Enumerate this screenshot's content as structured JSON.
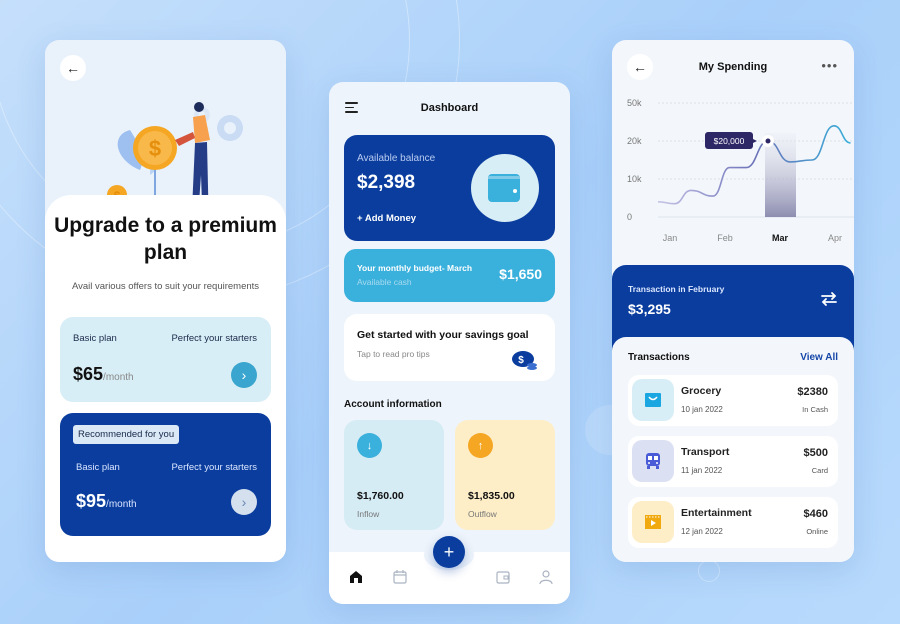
{
  "colors": {
    "primary": "#0a3d9e",
    "accent_cyan": "#3ab0dc",
    "accent_orange": "#f5a623",
    "tooltip": "#2e2766"
  },
  "upgrade_screen": {
    "back_icon": "arrow-left-icon",
    "title": "Upgrade to a premium plan",
    "subtitle": "Avail various offers to suit your requirements",
    "plans": [
      {
        "name": "Basic plan",
        "description": "Perfect your starters",
        "price": "$65",
        "period": "/month",
        "recommended": false
      },
      {
        "name": "Basic plan",
        "description": "Perfect your starters",
        "price": "$95",
        "period": "/month",
        "recommended": true,
        "badge": "Recommended for you"
      }
    ]
  },
  "dashboard": {
    "title": "Dashboard",
    "menu_icon": "hamburger-menu-icon",
    "balance": {
      "label": "Available balance",
      "value": "$2,398",
      "add_money": "Add Money"
    },
    "budget": {
      "title": "Your monthly budget- March",
      "subtitle": "Available cash",
      "value": "$1,650"
    },
    "savings": {
      "title": "Get started with your savings goal",
      "subtitle": "Tap to read pro tips"
    },
    "account_title": "Account information",
    "inflow": {
      "value": "$1,760.00",
      "label": "Inflow"
    },
    "outflow": {
      "value": "$1,835.00",
      "label": "Outflow"
    },
    "nav": [
      "home",
      "calendar",
      "wallet",
      "profile"
    ],
    "fab": "+"
  },
  "spending": {
    "title": "My Spending",
    "more_icon": "•••",
    "chart_data": {
      "type": "line",
      "title": "My Spending",
      "categories": [
        "Jan",
        "Feb",
        "Mar",
        "Apr"
      ],
      "y_ticks": [
        "0",
        "10k",
        "20k",
        "50k"
      ],
      "y_tick_values": [
        0,
        10000,
        20000,
        30000
      ],
      "x": [
        0,
        0.3,
        0.6,
        1,
        1.3,
        1.6,
        2,
        2.4,
        2.8,
        3.2,
        3.5
      ],
      "values": [
        4000,
        3500,
        7000,
        5500,
        13000,
        13000,
        20000,
        14500,
        15000,
        24000,
        19500
      ],
      "highlight": {
        "category": "Mar",
        "value": 20000,
        "label": "$20,000"
      },
      "grid": true,
      "xlabel": "",
      "ylabel": ""
    },
    "summary": {
      "label": "Transaction in February",
      "value": "$3,295"
    },
    "transactions_title": "Transactions",
    "view_all": "View All",
    "transactions": [
      {
        "name": "Grocery",
        "date": "10 jan 2022",
        "amount": "$2380",
        "method": "In Cash",
        "icon": "shopping-bag-icon",
        "bg": "#d8eef6",
        "color": "#1aa6e0"
      },
      {
        "name": "Transport",
        "date": "11 jan 2022",
        "amount": "$500",
        "method": "Card",
        "icon": "bus-icon",
        "bg": "#dce0f3",
        "color": "#4a5bd8"
      },
      {
        "name": "Entertainment",
        "date": "12 jan 2022",
        "amount": "$460",
        "method": "Online",
        "icon": "clapperboard-icon",
        "bg": "#fdeec8",
        "color": "#f0a90f"
      }
    ]
  }
}
